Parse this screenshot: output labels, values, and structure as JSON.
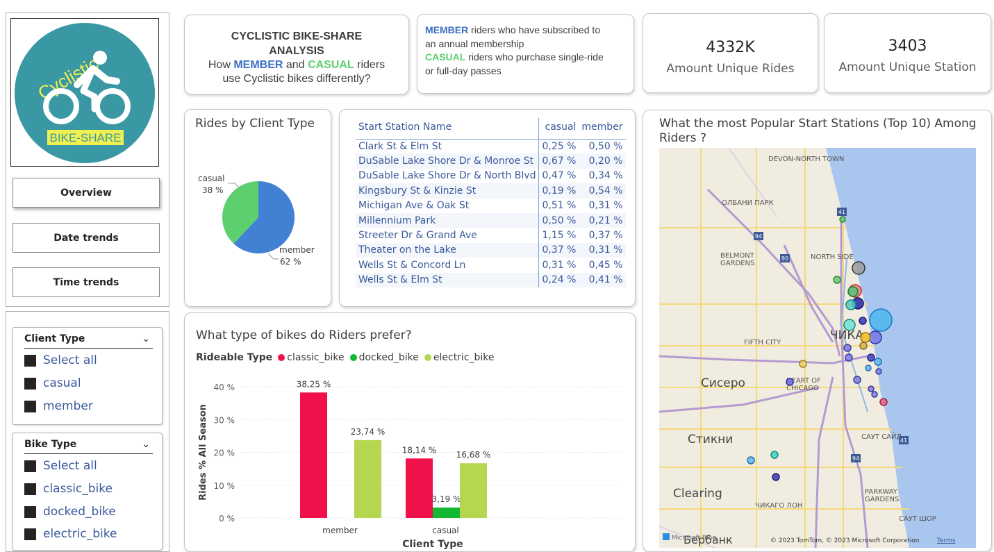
{
  "logo": {
    "text": "Cyclistic",
    "tag": "BIKE-SHARE",
    "bg_color": "#3a97a4",
    "tag_bg": "#f0f050"
  },
  "nav": {
    "overview": "Overview",
    "date_trends": "Date trends",
    "time_trends": "Time trends"
  },
  "client_slicer": {
    "title": "Client Type",
    "options": [
      "Select all",
      "casual",
      "member"
    ]
  },
  "bike_slicer": {
    "title": "Bike Type",
    "options": [
      "Select all",
      "classic_bike",
      "docked_bike",
      "electric_bike"
    ]
  },
  "header": {
    "title_line1": "CYCLISTIC BIKE-SHARE",
    "title_line2": "ANALYSIS",
    "sub_pre": "How ",
    "sub_member": "MEMBER",
    "sub_mid": " and ",
    "sub_casual": "CASUAL",
    "sub_post": " riders",
    "sub_line2": "use Cyclistic bikes differently?",
    "member_color": "#3a6fc4",
    "casual_color": "#5dcf6e"
  },
  "definitions": {
    "member_word": "MEMBER",
    "member_text": " riders who have subscribed to",
    "member_text2": "an annual membership",
    "casual_word": "CASUAL",
    "casual_text": " riders who purchase single-ride",
    "casual_text2": "or full-day passes"
  },
  "kpis": {
    "rides_value": "4332K",
    "rides_label": "Amount Unique Rides",
    "stations_value": "3403",
    "stations_label": "Amount Unique Station"
  },
  "pie": {
    "title": "Rides by Client Type",
    "casual_label": "casual",
    "casual_pct": "38 %",
    "member_label": "member",
    "member_pct": "62 %",
    "casual_share": 0.38,
    "member_share": 0.62,
    "casual_color": "#5dcf6e",
    "member_color": "#4180d3"
  },
  "station_table": {
    "headers": [
      "Start Station Name",
      "casual",
      "member"
    ],
    "rows": [
      [
        "Clark St & Elm St",
        "0,25 %",
        "0,50 %"
      ],
      [
        "DuSable Lake Shore Dr & Monroe St",
        "0,67 %",
        "0,20 %"
      ],
      [
        "DuSable Lake Shore Dr & North Blvd",
        "0,47 %",
        "0,34 %"
      ],
      [
        "Kingsbury St & Kinzie St",
        "0,19 %",
        "0,54 %"
      ],
      [
        "Michigan Ave & Oak St",
        "0,51 %",
        "0,31 %"
      ],
      [
        "Millennium Park",
        "0,50 %",
        "0,21 %"
      ],
      [
        "Streeter Dr & Grand Ave",
        "1,15 %",
        "0,37 %"
      ],
      [
        "Theater on the Lake",
        "0,37 %",
        "0,31 %"
      ],
      [
        "Wells St & Concord Ln",
        "0,31 %",
        "0,45 %"
      ],
      [
        "Wells St & Elm St",
        "0,24 %",
        "0,41 %"
      ]
    ]
  },
  "chart_data": {
    "type": "bar",
    "title": "What type of bikes do Riders prefer?",
    "legend_title": "Rideable Type",
    "categories": [
      "member",
      "casual"
    ],
    "series": [
      {
        "name": "classic_bike",
        "color": "#f0104a",
        "values": [
          38.25,
          18.14
        ],
        "labels": [
          "38,25 %",
          "18,14 %"
        ]
      },
      {
        "name": "docked_bike",
        "color": "#13b832",
        "values": [
          0,
          3.19
        ],
        "labels": [
          "",
          "3,19 %"
        ]
      },
      {
        "name": "electric_bike",
        "color": "#b5d651",
        "values": [
          23.74,
          16.68
        ],
        "labels": [
          "23,74 %",
          "16,68 %"
        ]
      }
    ],
    "ylabel": "Rides % All Season",
    "xlabel": "Client Type",
    "ylim": [
      0,
      40
    ],
    "yticks": [
      "0 %",
      "10 %",
      "20 %",
      "30 %",
      "40 %"
    ],
    "grid": true,
    "legend_position": "top-left"
  },
  "map": {
    "title_line1": "What the most Popular Start Stations (Top 10) Among",
    "title_line2": "Riders ?",
    "labels": [
      "DEVON-NORTH TOWN",
      "ОЛБАНИ ПАРК",
      "BELMONT",
      "GARDENS",
      "NORTH SIDE",
      "ЧИКА",
      "FIFTH CITY",
      "HEART OF",
      "CHICAGO",
      "Сисеро",
      "Стикни",
      "САУТ САЙД",
      "Clearing",
      "ЧИКАГО ЛОН",
      "PARKWAY",
      "GARDENS",
      "САУТ ШОР",
      "Бербанк"
    ],
    "shields": [
      "41",
      "94",
      "90",
      "41",
      "94"
    ],
    "attribution": "© 2023 TomTom, © 2023 Microsoft Corporation",
    "terms": "Terms",
    "brand": "Microsoft Bing"
  }
}
